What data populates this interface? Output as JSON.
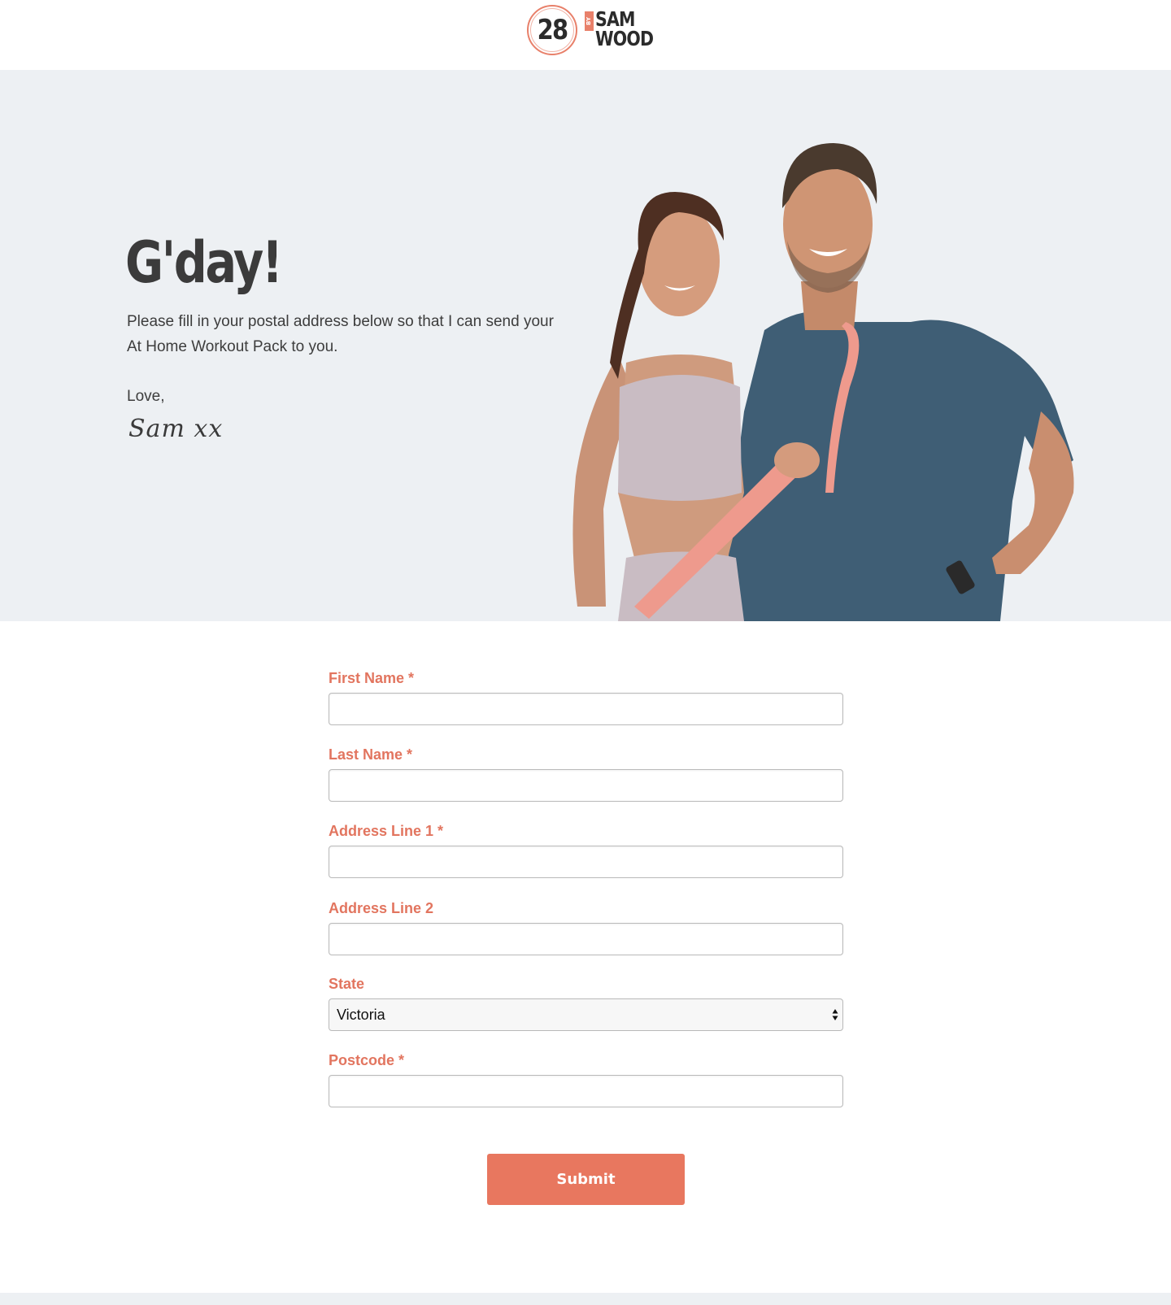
{
  "header": {
    "logo": {
      "number": "28",
      "by": "BY",
      "word1": "SAM",
      "word2": "WOOD"
    }
  },
  "hero": {
    "title": "G'day!",
    "text": "Please fill in your postal address below so that I can send your At Home Workout Pack to you.",
    "love": "Love,",
    "signature": "Sam xx"
  },
  "form": {
    "first_name_label": "First Name *",
    "last_name_label": "Last Name *",
    "address1_label": "Address Line 1 *",
    "address2_label": "Address Line 2",
    "state_label": "State",
    "state_value": "Victoria",
    "postcode_label": "Postcode *",
    "submit_label": "Submit"
  },
  "colors": {
    "accent": "#e8775f",
    "hero_bg": "#edf0f3",
    "text": "#3d3d3d"
  }
}
